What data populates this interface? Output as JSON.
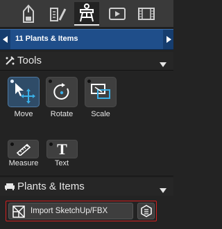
{
  "tabs": [
    {
      "name": "pencil-icon",
      "active": false
    },
    {
      "name": "edit-tools-icon",
      "active": false
    },
    {
      "name": "easel-icon",
      "active": true
    },
    {
      "name": "video-icon",
      "active": false
    },
    {
      "name": "film-strip-icon",
      "active": false
    }
  ],
  "nav": {
    "title": "11 Plants & Items"
  },
  "tools_section": {
    "title": "Tools",
    "buttons": [
      {
        "label": "Move",
        "selected": true,
        "icon": "move-cursor-icon"
      },
      {
        "label": "Rotate",
        "selected": false,
        "icon": "rotate-icon"
      },
      {
        "label": "Scale",
        "selected": false,
        "icon": "scale-icon"
      },
      {
        "label": "Measure",
        "selected": false,
        "icon": "ruler-icon"
      },
      {
        "label": "Text",
        "selected": false,
        "icon": "text-T-icon"
      }
    ]
  },
  "plants_section": {
    "title": "Plants & Items",
    "import_label": "Import SketchUp/FBX"
  },
  "colors": {
    "accent_blue": "#1f4e8a",
    "selected_tool": "#2f4c68",
    "highlight_red": "#d32020",
    "icon_cyan": "#3ab0e8"
  }
}
